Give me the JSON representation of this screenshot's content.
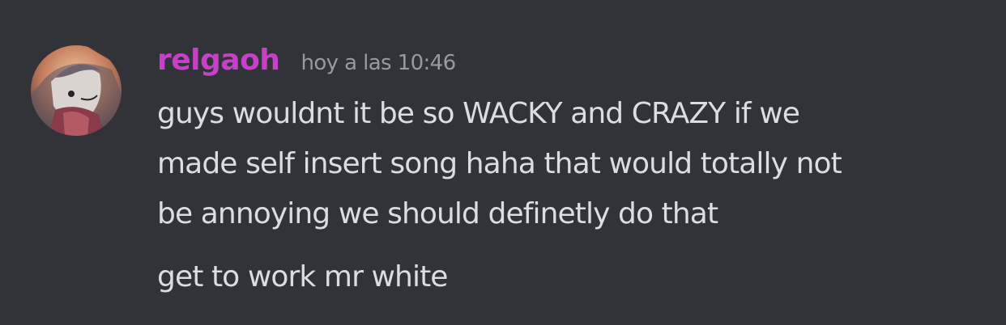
{
  "message": {
    "author": {
      "username": "relgaoh",
      "avatar_icon": "user-avatar-icon",
      "name_color": "#c640c8"
    },
    "timestamp": "hoy a las 10:46",
    "lines": [
      "guys wouldnt it be so WACKY and CRAZY if we",
      "made self insert song haha that would totally not",
      "be annoying we should definetly do that"
    ],
    "followup": "get to work mr white"
  },
  "colors": {
    "background": "#313338",
    "text": "#dbdee1",
    "muted": "#949ba4"
  }
}
